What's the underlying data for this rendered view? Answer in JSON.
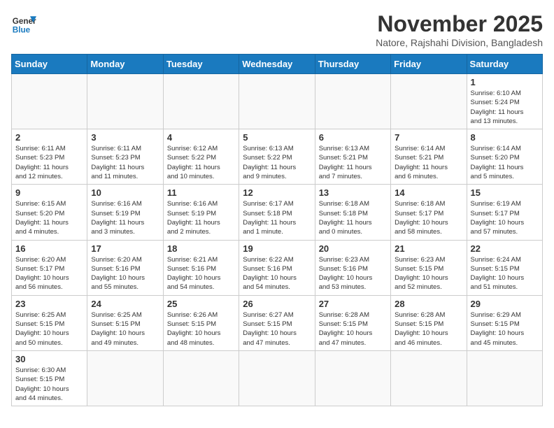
{
  "header": {
    "logo_line1": "General",
    "logo_line2": "Blue",
    "title": "November 2025",
    "subtitle": "Natore, Rajshahi Division, Bangladesh"
  },
  "weekdays": [
    "Sunday",
    "Monday",
    "Tuesday",
    "Wednesday",
    "Thursday",
    "Friday",
    "Saturday"
  ],
  "weeks": [
    [
      {
        "day": "",
        "info": ""
      },
      {
        "day": "",
        "info": ""
      },
      {
        "day": "",
        "info": ""
      },
      {
        "day": "",
        "info": ""
      },
      {
        "day": "",
        "info": ""
      },
      {
        "day": "",
        "info": ""
      },
      {
        "day": "1",
        "info": "Sunrise: 6:10 AM\nSunset: 5:24 PM\nDaylight: 11 hours\nand 13 minutes."
      }
    ],
    [
      {
        "day": "2",
        "info": "Sunrise: 6:11 AM\nSunset: 5:23 PM\nDaylight: 11 hours\nand 12 minutes."
      },
      {
        "day": "3",
        "info": "Sunrise: 6:11 AM\nSunset: 5:23 PM\nDaylight: 11 hours\nand 11 minutes."
      },
      {
        "day": "4",
        "info": "Sunrise: 6:12 AM\nSunset: 5:22 PM\nDaylight: 11 hours\nand 10 minutes."
      },
      {
        "day": "5",
        "info": "Sunrise: 6:13 AM\nSunset: 5:22 PM\nDaylight: 11 hours\nand 9 minutes."
      },
      {
        "day": "6",
        "info": "Sunrise: 6:13 AM\nSunset: 5:21 PM\nDaylight: 11 hours\nand 7 minutes."
      },
      {
        "day": "7",
        "info": "Sunrise: 6:14 AM\nSunset: 5:21 PM\nDaylight: 11 hours\nand 6 minutes."
      },
      {
        "day": "8",
        "info": "Sunrise: 6:14 AM\nSunset: 5:20 PM\nDaylight: 11 hours\nand 5 minutes."
      }
    ],
    [
      {
        "day": "9",
        "info": "Sunrise: 6:15 AM\nSunset: 5:20 PM\nDaylight: 11 hours\nand 4 minutes."
      },
      {
        "day": "10",
        "info": "Sunrise: 6:16 AM\nSunset: 5:19 PM\nDaylight: 11 hours\nand 3 minutes."
      },
      {
        "day": "11",
        "info": "Sunrise: 6:16 AM\nSunset: 5:19 PM\nDaylight: 11 hours\nand 2 minutes."
      },
      {
        "day": "12",
        "info": "Sunrise: 6:17 AM\nSunset: 5:18 PM\nDaylight: 11 hours\nand 1 minute."
      },
      {
        "day": "13",
        "info": "Sunrise: 6:18 AM\nSunset: 5:18 PM\nDaylight: 11 hours\nand 0 minutes."
      },
      {
        "day": "14",
        "info": "Sunrise: 6:18 AM\nSunset: 5:17 PM\nDaylight: 10 hours\nand 58 minutes."
      },
      {
        "day": "15",
        "info": "Sunrise: 6:19 AM\nSunset: 5:17 PM\nDaylight: 10 hours\nand 57 minutes."
      }
    ],
    [
      {
        "day": "16",
        "info": "Sunrise: 6:20 AM\nSunset: 5:17 PM\nDaylight: 10 hours\nand 56 minutes."
      },
      {
        "day": "17",
        "info": "Sunrise: 6:20 AM\nSunset: 5:16 PM\nDaylight: 10 hours\nand 55 minutes."
      },
      {
        "day": "18",
        "info": "Sunrise: 6:21 AM\nSunset: 5:16 PM\nDaylight: 10 hours\nand 54 minutes."
      },
      {
        "day": "19",
        "info": "Sunrise: 6:22 AM\nSunset: 5:16 PM\nDaylight: 10 hours\nand 54 minutes."
      },
      {
        "day": "20",
        "info": "Sunrise: 6:23 AM\nSunset: 5:16 PM\nDaylight: 10 hours\nand 53 minutes."
      },
      {
        "day": "21",
        "info": "Sunrise: 6:23 AM\nSunset: 5:15 PM\nDaylight: 10 hours\nand 52 minutes."
      },
      {
        "day": "22",
        "info": "Sunrise: 6:24 AM\nSunset: 5:15 PM\nDaylight: 10 hours\nand 51 minutes."
      }
    ],
    [
      {
        "day": "23",
        "info": "Sunrise: 6:25 AM\nSunset: 5:15 PM\nDaylight: 10 hours\nand 50 minutes."
      },
      {
        "day": "24",
        "info": "Sunrise: 6:25 AM\nSunset: 5:15 PM\nDaylight: 10 hours\nand 49 minutes."
      },
      {
        "day": "25",
        "info": "Sunrise: 6:26 AM\nSunset: 5:15 PM\nDaylight: 10 hours\nand 48 minutes."
      },
      {
        "day": "26",
        "info": "Sunrise: 6:27 AM\nSunset: 5:15 PM\nDaylight: 10 hours\nand 47 minutes."
      },
      {
        "day": "27",
        "info": "Sunrise: 6:28 AM\nSunset: 5:15 PM\nDaylight: 10 hours\nand 47 minutes."
      },
      {
        "day": "28",
        "info": "Sunrise: 6:28 AM\nSunset: 5:15 PM\nDaylight: 10 hours\nand 46 minutes."
      },
      {
        "day": "29",
        "info": "Sunrise: 6:29 AM\nSunset: 5:15 PM\nDaylight: 10 hours\nand 45 minutes."
      }
    ],
    [
      {
        "day": "30",
        "info": "Sunrise: 6:30 AM\nSunset: 5:15 PM\nDaylight: 10 hours\nand 44 minutes."
      },
      {
        "day": "",
        "info": ""
      },
      {
        "day": "",
        "info": ""
      },
      {
        "day": "",
        "info": ""
      },
      {
        "day": "",
        "info": ""
      },
      {
        "day": "",
        "info": ""
      },
      {
        "day": "",
        "info": ""
      }
    ]
  ]
}
